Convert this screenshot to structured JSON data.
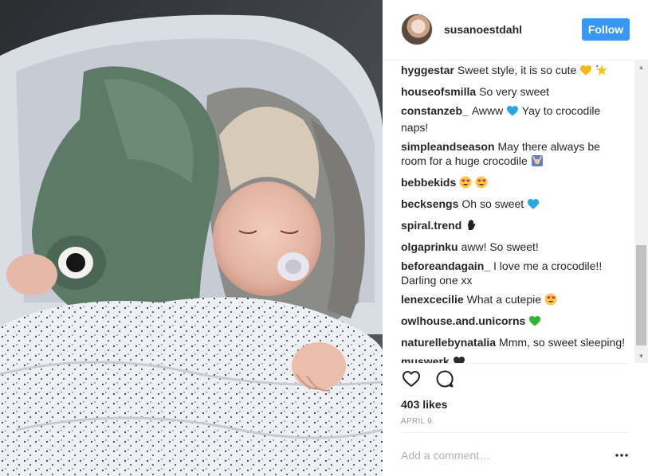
{
  "post": {
    "username": "susanoestdahl",
    "follow_label": "Follow",
    "likes": "403 likes",
    "date": "APRIL 9",
    "comment_placeholder": "Add a comment…"
  },
  "comments": [
    {
      "author": "hyggestar",
      "text": "Sweet style, it is so cute",
      "emoji": [
        "yellow-heart",
        "sparkle-star"
      ]
    },
    {
      "author": "houseofsmilla",
      "text": "So very sweet",
      "emoji": []
    },
    {
      "author": "constanzeb_",
      "text": "Awww",
      "emoji": [
        "blue-heart"
      ],
      "text2": "Yay to crocodile naps!"
    },
    {
      "author": "simpleandseason",
      "text": "May there always be room for a huge crocodile",
      "emoji": [
        "raising-hands"
      ]
    },
    {
      "author": "bebbekids",
      "text": "",
      "emoji": [
        "heart-eyes",
        "heart-eyes"
      ]
    },
    {
      "author": "becksengs",
      "text": "Oh so sweet",
      "emoji": [
        "blue-heart"
      ]
    },
    {
      "author": "spiral.trend",
      "text": "",
      "emoji": [
        "raised-hand"
      ]
    },
    {
      "author": "olgaprinku",
      "text": "aww! So sweet!",
      "emoji": []
    },
    {
      "author": "beforeandagain_",
      "text": "I love me a crocodile!! Darling one xx",
      "emoji": []
    },
    {
      "author": "lenexcecilie",
      "text": "What a cutepie",
      "emoji": [
        "heart-eyes"
      ]
    },
    {
      "author": "owlhouse.and.unicorns",
      "text": "",
      "emoji": [
        "green-heart"
      ]
    },
    {
      "author": "naturellebynatalia",
      "text": "Mmm, so sweet sleeping!",
      "emoji": []
    },
    {
      "author": "muswerk",
      "text": "",
      "emoji": [
        "black-heart"
      ]
    }
  ],
  "colors": {
    "accent": "#3897f0",
    "text": "#262626",
    "muted": "#999999",
    "placeholder": "#b2b2b2"
  },
  "icons": {
    "like": "heart-outline-icon",
    "comment": "speech-bubble-icon",
    "more": "ellipsis-icon"
  }
}
